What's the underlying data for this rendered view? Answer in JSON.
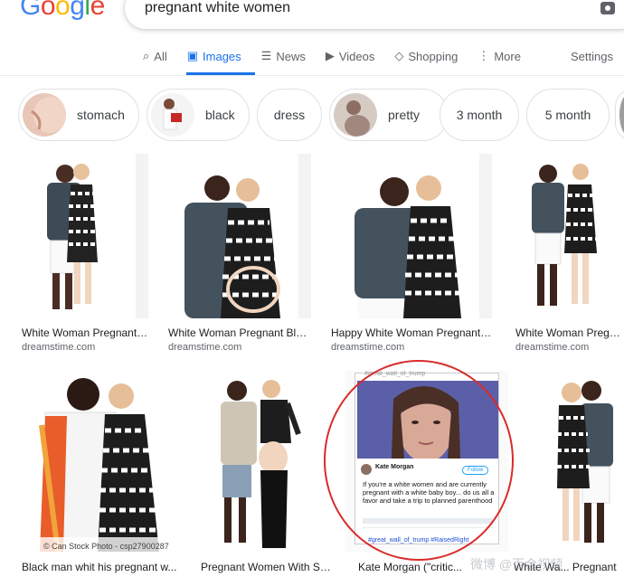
{
  "logo": {
    "letters": [
      "G",
      "o",
      "o",
      "g",
      "l",
      "e"
    ],
    "colors": [
      "#4285F4",
      "#EA4335",
      "#FBBC05",
      "#4285F4",
      "#34A853",
      "#EA4335"
    ]
  },
  "search": {
    "query": "pregnant white women",
    "camera_icon": "camera-icon"
  },
  "tabs": [
    {
      "label": "All",
      "icon": "search-icon",
      "glyph": "⌕"
    },
    {
      "label": "Images",
      "icon": "images-icon",
      "glyph": "▣"
    },
    {
      "label": "News",
      "icon": "news-icon",
      "glyph": "☰"
    },
    {
      "label": "Videos",
      "icon": "videos-icon",
      "glyph": "▶"
    },
    {
      "label": "Shopping",
      "icon": "tag-icon",
      "glyph": "◇"
    },
    {
      "label": "More",
      "icon": "more-icon",
      "glyph": "⋮"
    }
  ],
  "settings_label": "Settings",
  "chips": [
    {
      "label": "stomach",
      "has_thumb": true
    },
    {
      "label": "black",
      "has_thumb": true
    },
    {
      "label": "dress",
      "has_thumb": false
    },
    {
      "label": "pretty",
      "has_thumb": true
    },
    {
      "label": "3 month",
      "has_thumb": false
    },
    {
      "label": "5 month",
      "has_thumb": false
    }
  ],
  "row1": [
    {
      "title": "White Woman Pregnant ...",
      "source": "dreamstime.com"
    },
    {
      "title": "White Woman Pregnant Bla...",
      "source": "dreamstime.com"
    },
    {
      "title": "Happy White Woman Pregnant, ...",
      "source": "dreamstime.com"
    },
    {
      "title": "White Woman Pregnant",
      "source": "dreamstime.com"
    }
  ],
  "row2": [
    {
      "title": "Black man whit his pregnant w...",
      "caption": "© Can Stock Photo - csp27900287"
    },
    {
      "title": "Pregnant Women With Sus..."
    },
    {
      "title": "Kate Morgan (\"critic...",
      "tweet": {
        "handle_top": "#great_wall_of_trump",
        "name": "Kate Morgan",
        "follow": "Follow",
        "text": "If you're a white women and are currently pregnant with a white baby boy... do us all a favor and take a trip to planned parenthood",
        "hashtags": "#great_wall_of_trump #RaisedRight"
      }
    },
    {
      "title": "White Wa... Pregnant"
    }
  ],
  "watermark": "微博 @百合视频"
}
